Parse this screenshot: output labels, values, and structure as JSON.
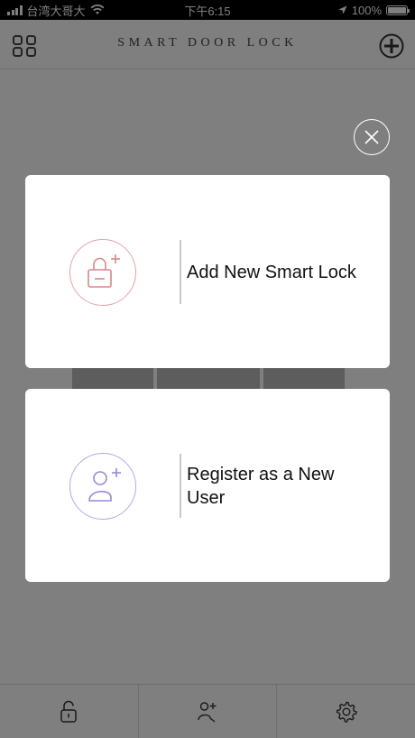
{
  "status_bar": {
    "carrier": "台湾大哥大",
    "time": "下午6:15",
    "battery": "100%"
  },
  "header": {
    "title": "SMART DOOR LOCK",
    "left_icon": "grid-icon",
    "right_icon": "plus-circle-icon"
  },
  "modal": {
    "close_icon": "close-icon",
    "options": [
      {
        "icon": "lock-plus-icon",
        "label": "Add New Smart Lock",
        "color": "#d9868b"
      },
      {
        "icon": "user-plus-icon",
        "label": "Register as a New User",
        "color": "#9a87d6"
      }
    ]
  },
  "tabbar": {
    "items": [
      {
        "icon": "unlock-icon"
      },
      {
        "icon": "add-user-icon"
      },
      {
        "icon": "gear-icon"
      }
    ]
  },
  "colors": {
    "overlay": "#808080",
    "lock_accent": "#d9868b",
    "user_accent": "#9a87d6"
  }
}
